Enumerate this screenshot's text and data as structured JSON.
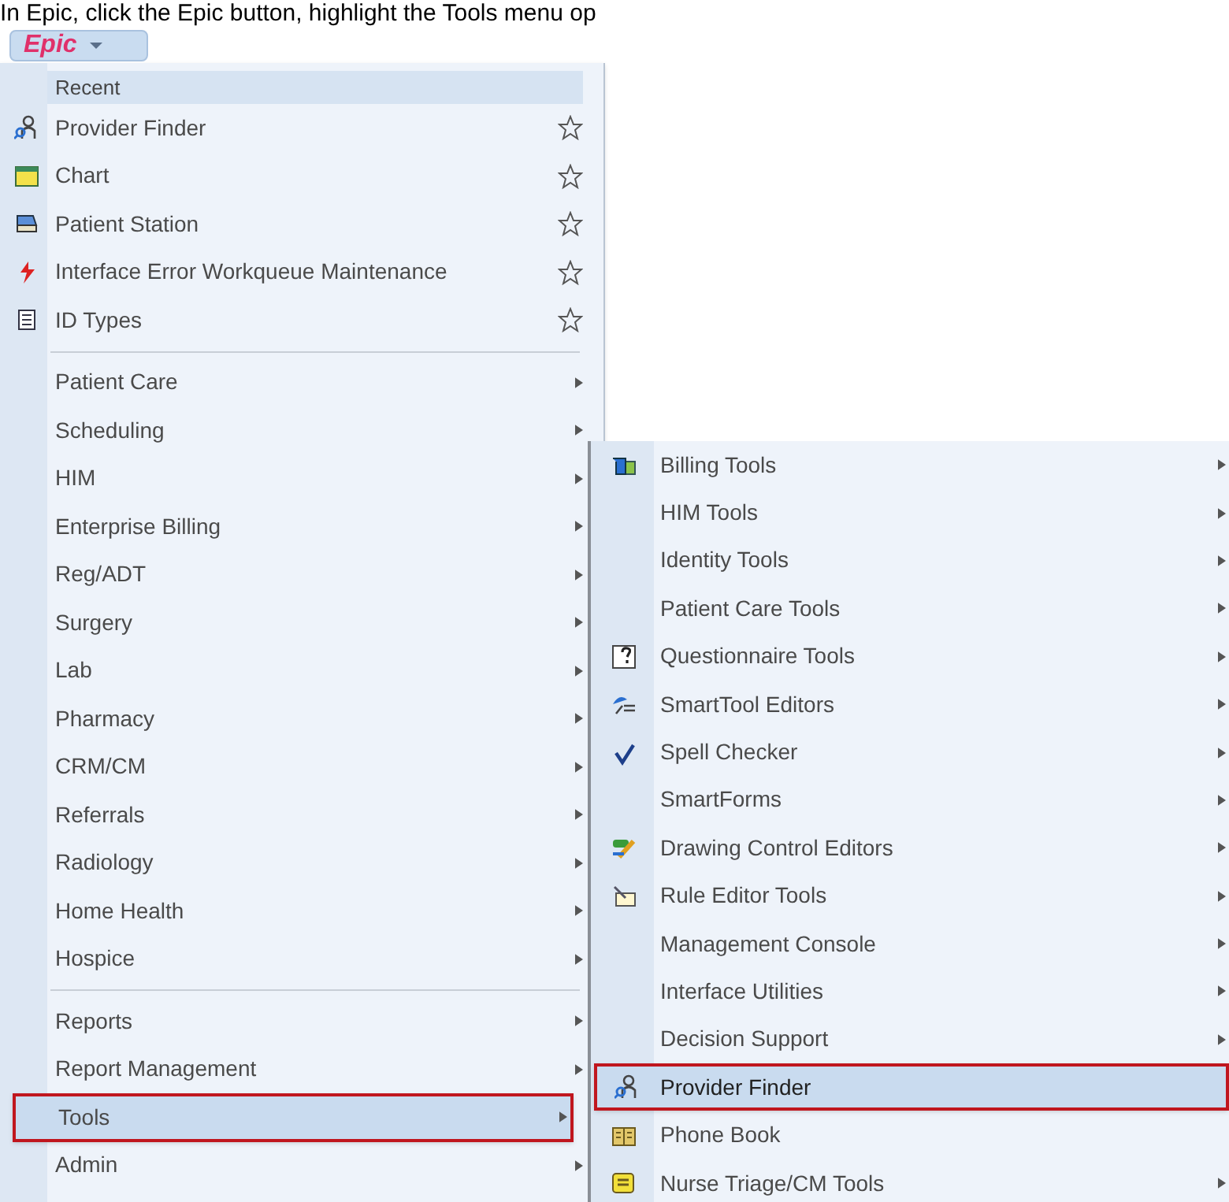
{
  "instruction": {
    "text": "In Epic, click the Epic button, highlight the Tools menu op"
  },
  "epic_button": {
    "label": "Epic"
  },
  "main_menu": {
    "sections": [
      {
        "header": "Recent",
        "items": [
          {
            "label": "Provider Finder",
            "starred": false
          },
          {
            "label": "Chart",
            "starred": false
          },
          {
            "label": "Patient Station",
            "starred": false
          },
          {
            "label": "Interface Error Workqueue Maintenance",
            "starred": false
          },
          {
            "label": "ID Types",
            "starred": false
          }
        ]
      },
      {
        "items": [
          {
            "label": "Patient Care",
            "has_submenu": true,
            "selected": false
          },
          {
            "label": "Scheduling",
            "has_submenu": true,
            "selected": false
          },
          {
            "label": "HIM",
            "has_submenu": true,
            "selected": false
          },
          {
            "label": "Enterprise Billing",
            "has_submenu": true,
            "selected": false
          },
          {
            "label": "Reg/ADT",
            "has_submenu": true,
            "selected": false
          },
          {
            "label": "Surgery",
            "has_submenu": true,
            "selected": false
          },
          {
            "label": "Lab",
            "has_submenu": true,
            "selected": false
          },
          {
            "label": "Pharmacy",
            "has_submenu": true,
            "selected": false
          },
          {
            "label": "CRM/CM",
            "has_submenu": true,
            "selected": false
          },
          {
            "label": "Referrals",
            "has_submenu": true,
            "selected": false
          },
          {
            "label": "Radiology",
            "has_submenu": true,
            "selected": false
          },
          {
            "label": "Home Health",
            "has_submenu": true,
            "selected": false
          },
          {
            "label": "Hospice",
            "has_submenu": true,
            "selected": false
          }
        ]
      },
      {
        "items": [
          {
            "label": "Reports",
            "has_submenu": true,
            "selected": false
          },
          {
            "label": "Report Management",
            "has_submenu": true,
            "selected": false
          },
          {
            "label": "Tools",
            "has_submenu": true,
            "selected": true
          },
          {
            "label": "Admin",
            "has_submenu": true,
            "selected": false
          }
        ]
      }
    ]
  },
  "tools_submenu": {
    "items": [
      {
        "label": "Billing Tools",
        "has_submenu": true,
        "selected": false
      },
      {
        "label": "HIM Tools",
        "has_submenu": true,
        "selected": false
      },
      {
        "label": "Identity Tools",
        "has_submenu": true,
        "selected": false
      },
      {
        "label": "Patient Care Tools",
        "has_submenu": true,
        "selected": false
      },
      {
        "label": "Questionnaire Tools",
        "has_submenu": true,
        "selected": false
      },
      {
        "label": "SmartTool Editors",
        "has_submenu": true,
        "selected": false
      },
      {
        "label": "Spell Checker",
        "has_submenu": true,
        "selected": false
      },
      {
        "label": "SmartForms",
        "has_submenu": true,
        "selected": false
      },
      {
        "label": "Drawing Control Editors",
        "has_submenu": true,
        "selected": false
      },
      {
        "label": "Rule Editor Tools",
        "has_submenu": true,
        "selected": false
      },
      {
        "label": "Management Console",
        "has_submenu": true,
        "selected": false
      },
      {
        "label": "Interface Utilities",
        "has_submenu": true,
        "selected": false
      },
      {
        "label": "Decision Support",
        "has_submenu": true,
        "selected": false
      },
      {
        "label": "Provider Finder",
        "has_submenu": false,
        "selected": true
      },
      {
        "label": "Phone Book",
        "has_submenu": false,
        "selected": false
      },
      {
        "label": "Nurse Triage/CM Tools",
        "has_submenu": true,
        "selected": false
      }
    ]
  }
}
